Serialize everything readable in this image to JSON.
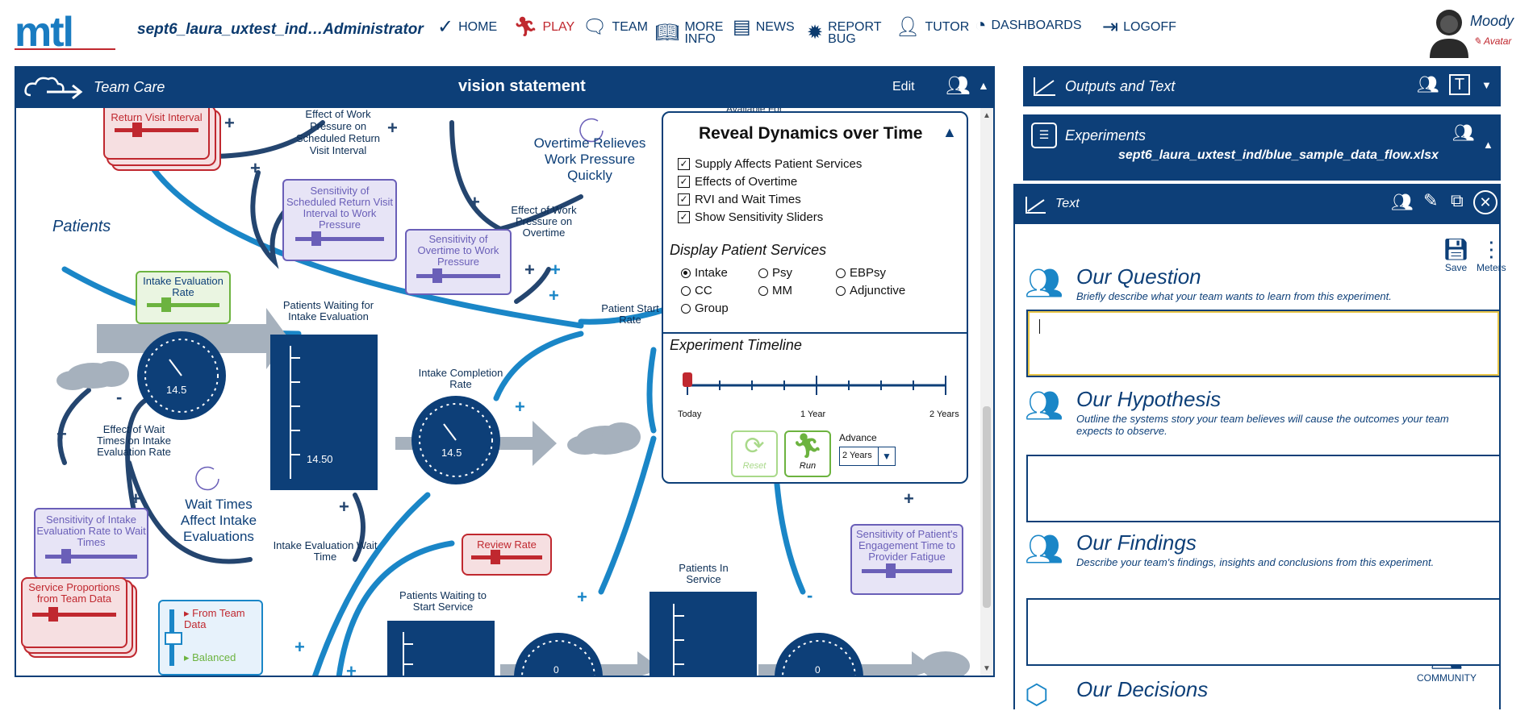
{
  "app": {
    "logo": "mtl",
    "user_label": "sept6_laura_uxtest_ind…Administrator"
  },
  "nav": {
    "home": "HOME",
    "play": "PLAY",
    "team": "TEAM",
    "more_1": "MORE",
    "more_2": "INFO",
    "news": "NEWS",
    "report_1": "REPORT",
    "report_2": "BUG",
    "tutor": "TUTOR",
    "dashboards": "DASHBOARDS",
    "logoff": "LOGOFF"
  },
  "account": {
    "name": "Moody",
    "sub": "Avatar"
  },
  "main": {
    "section": "Team Care",
    "title": "vision statement",
    "edit": "Edit"
  },
  "diagram": {
    "patients": "Patients",
    "return_visit": "Return Visit Interval",
    "effect_work_sched": "Effect of Work Pressure on Scheduled Return Visit Interval",
    "sens_sched": "Sensitivity of Scheduled Return Visit Interval to Work Pressure",
    "sens_overtime": "Sensitivity of Overtime to Work Pressure",
    "effect_work_overtime": "Effect of Work Pressure on Overtime",
    "overtime_loop": "Overtime Relieves Work Pressure Quickly",
    "available": "Available For",
    "intake_eval_rate": "Intake Evaluation Rate",
    "patients_waiting_intake": "Patients Waiting for Intake Evaluation",
    "patient_start_rate": "Patient Start Rate",
    "intake_completion_rate": "Intake Completion Rate",
    "dial1": "14.5",
    "dial2": "14.5",
    "stock1": "14.50",
    "effect_wait": "Effect of Wait Times on Intake Evaluation Rate",
    "wait_loop": "Wait Times Affect Intake Evaluations",
    "sens_intake": "Sensitivity of Intake Evaluation Rate to Wait Times",
    "intake_wait": "Intake Evaluation Wait Time",
    "review_rate": "Review Rate",
    "service_props": "Service Proportions from Team Data",
    "from_team": "From Team Data",
    "balanced": "Balanced",
    "patients_waiting_start": "Patients Waiting to Start Service",
    "patients_in_service": "Patients In Service",
    "sens_engagement": "Sensitivity of Patient's Engagement Time to Provider Fatigue",
    "dial3": "0",
    "dial4": "0"
  },
  "reveal": {
    "title": "Reveal Dynamics over Time",
    "checks": [
      "Supply Affects Patient Services",
      "Effects of Overtime",
      "RVI and Wait Times",
      "Show Sensitivity Sliders"
    ],
    "services_title": "Display Patient Services",
    "radios": [
      "Intake",
      "Psy",
      "EBPsy",
      "CC",
      "MM",
      "Adjunctive",
      "Group"
    ],
    "timeline_title": "Experiment Timeline",
    "today": "Today",
    "year1": "1 Year",
    "year2": "2 Years",
    "reset": "Reset",
    "run": "Run",
    "advance": "Advance",
    "advance_value": "2 Years"
  },
  "right": {
    "outputs": "Outputs and Text",
    "experiments": "Experiments",
    "file": "sept6_laura_uxtest_ind/blue_sample_data_flow.xlsx",
    "text": "Text",
    "save": "Save",
    "meters": "Meters",
    "q_title": "Our Question",
    "q_desc": "Briefly describe what your team wants to learn from this experiment.",
    "h_title": "Our Hypothesis",
    "h_desc": "Outline the systems story your team believes will cause the outcomes your team expects to observe.",
    "f_title": "Our Findings",
    "f_desc": "Describe your team's findings, insights and conclusions from this experiment.",
    "d_title": "Our Decisions",
    "community": "COMMUNITY"
  }
}
